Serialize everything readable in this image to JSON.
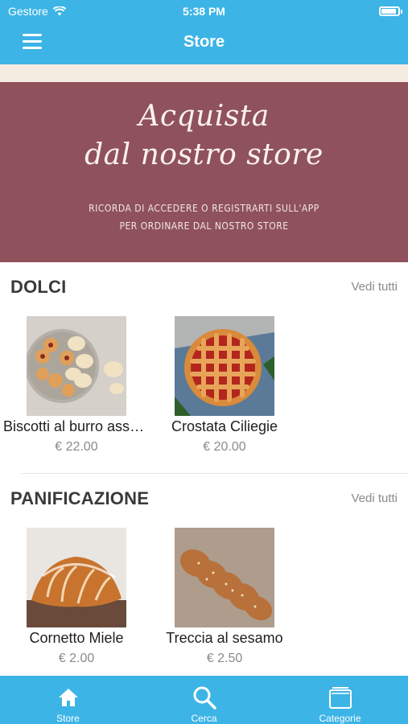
{
  "status_bar": {
    "carrier": "Gestore",
    "time": "5:38 PM"
  },
  "nav": {
    "title": "Store"
  },
  "banner": {
    "headline_line1": "Acquista",
    "headline_line2": "dal nostro store",
    "note_line1": "RICORDA DI ACCEDERE O REGISTRARTI SULL'APP",
    "note_line2": "PER ORDINARE DAL NOSTRO STORE"
  },
  "sections": [
    {
      "title": "DOLCI",
      "see_all": "Vedi tutti",
      "products": [
        {
          "name": "Biscotti al burro asso…",
          "price": "€ 22.00"
        },
        {
          "name": "Crostata Ciliegie",
          "price": "€ 20.00"
        }
      ]
    },
    {
      "title": "PANIFICAZIONE",
      "see_all": "Vedi tutti",
      "products": [
        {
          "name": "Cornetto Miele",
          "price": "€ 2.00"
        },
        {
          "name": "Treccia al sesamo",
          "price": "€ 2.50"
        }
      ]
    }
  ],
  "tabbar": {
    "items": [
      {
        "label": "Store",
        "icon": "home-icon"
      },
      {
        "label": "Cerca",
        "icon": "search-icon"
      },
      {
        "label": "Categorie",
        "icon": "categories-icon"
      }
    ]
  },
  "colors": {
    "primary": "#3db4e6",
    "banner": "#8f525c",
    "stripe": "#f4ebe1"
  }
}
